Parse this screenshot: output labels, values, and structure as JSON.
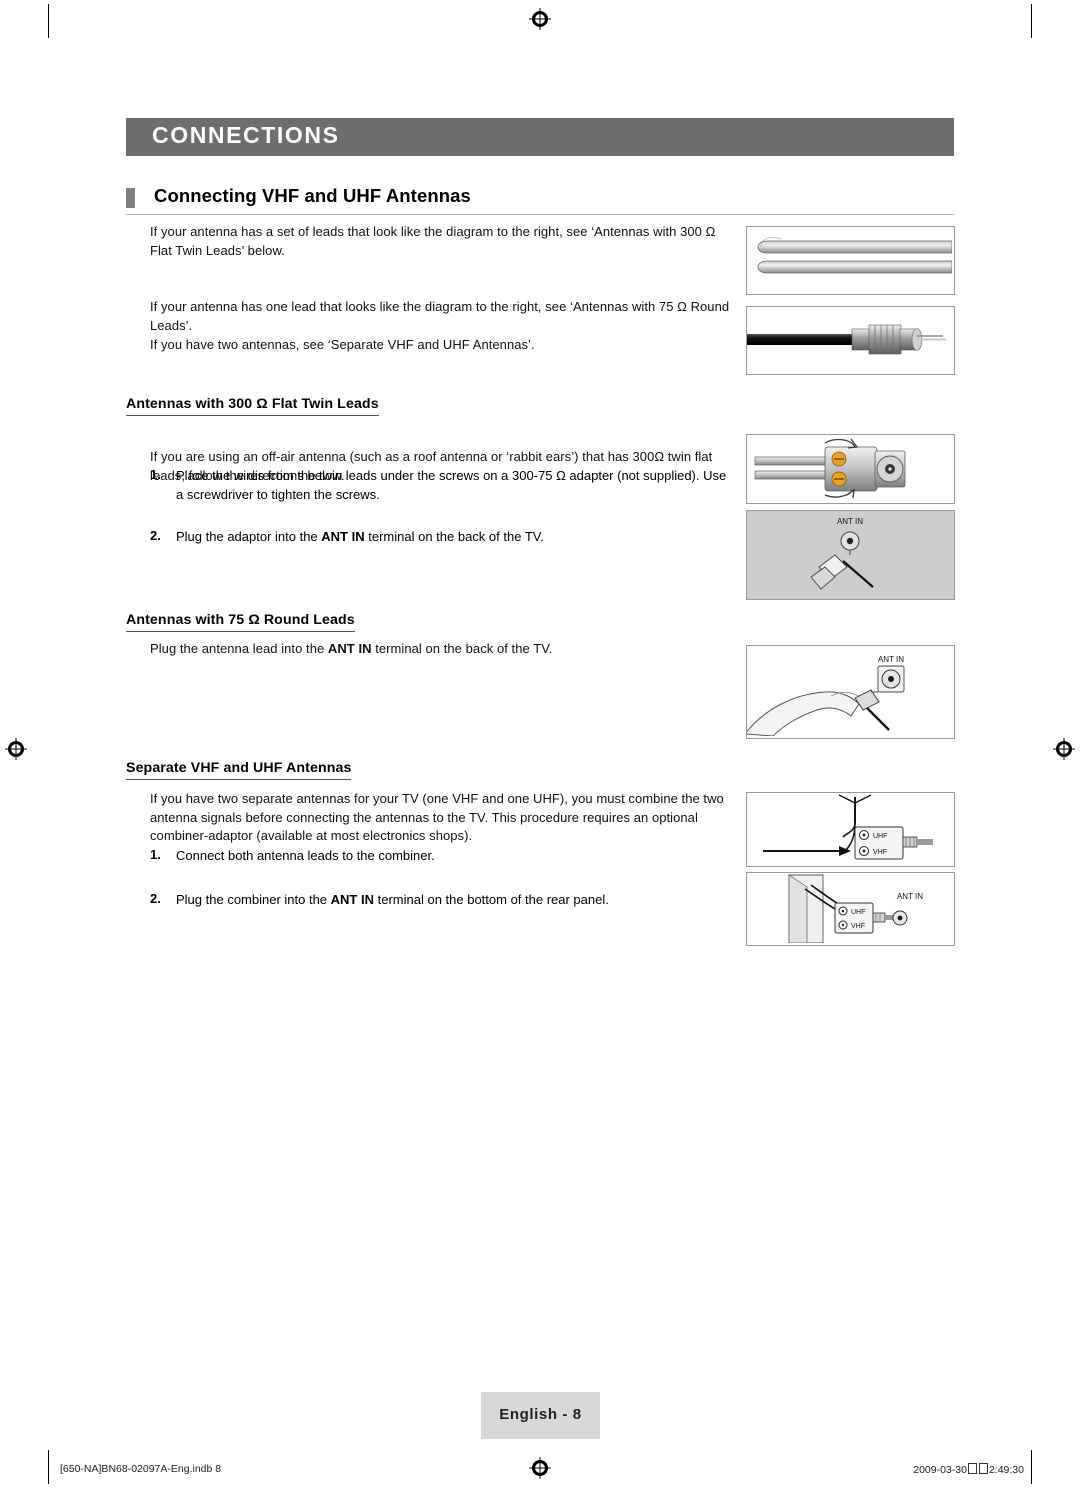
{
  "page": {
    "chapter": "CONNECTIONS",
    "section_title": "Connecting VHF and UHF Antennas",
    "intro_1": "If your antenna has a set of leads that look like the diagram to the right, see ‘Antennas with 300 Ω Flat Twin Leads’ below.",
    "intro_2": "If your antenna has one lead that looks like the diagram to the right, see ‘Antennas with 75 Ω Round Leads’.",
    "intro_3": "If you have two antennas, see ‘Separate VHF and UHF Antennas’.",
    "sub1_title": "Antennas with 300 Ω Flat Twin Leads",
    "sub1_para": "If you are using an off-air antenna (such as a roof antenna or ‘rabbit ears’) that has 300Ω twin flat leads, follow the directions below.",
    "sub1_step1_num": "1.",
    "sub1_step1": "Place the wires from the twin leads under the screws on a 300-75 Ω adapter (not supplied). Use a screwdriver to tighten the screws.",
    "sub1_step2_num": "2.",
    "sub1_step2_a": "Plug the adaptor into the ",
    "sub1_step2_b": "ANT IN",
    "sub1_step2_c": " terminal on the back of the TV.",
    "sub2_title": "Antennas with 75 Ω Round Leads",
    "sub2_para_a": "Plug the antenna lead into the ",
    "sub2_para_b": "ANT IN",
    "sub2_para_c": " terminal on the back of the TV.",
    "sub3_title": "Separate VHF and UHF Antennas",
    "sub3_para": "If you have two separate antennas for your TV (one VHF and one UHF), you must combine the two antenna signals before connecting the antennas to the TV. This procedure requires an optional combiner-adaptor (available at most electronics shops).",
    "sub3_step1_num": "1.",
    "sub3_step1": "Connect both antenna leads to the combiner.",
    "sub3_step2_num": "2.",
    "sub3_step2_a": "Plug the combiner into the ",
    "sub3_step2_b": "ANT IN",
    "sub3_step2_c": " terminal on the bottom of the rear panel.",
    "figure_labels": {
      "ant_in": "ANT IN",
      "uhf": "UHF",
      "vhf": "VHF"
    },
    "footer_language": "English - 8",
    "footer_file": "[650-NA]BN68-02097A-Eng.indb   8",
    "footer_date": "2009-03-30",
    "footer_time": "2:49:30"
  }
}
